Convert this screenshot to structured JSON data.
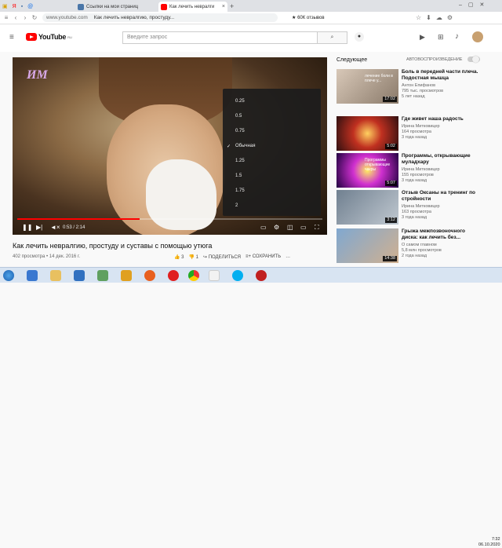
{
  "browser": {
    "tabs": [
      {
        "label": "Ссылки на мои страниц",
        "color": "#4a76a8"
      },
      {
        "label": "Как лечить невралги",
        "color": "#ff0000"
      }
    ],
    "url_domain": "www.youtube.com",
    "url_rest": "Как лечить невралгию, простуду...",
    "rating_star": "★",
    "rating_label": "60К отзывов"
  },
  "header": {
    "logo_text": "YouTube",
    "logo_region": "RU",
    "search_placeholder": "Введите запрос"
  },
  "player": {
    "watermark": "ИМ",
    "time": "0:53 / 2:14",
    "progress": 0.4,
    "speed_options": [
      "0.25",
      "0.5",
      "0.75",
      "Обычная",
      "1.25",
      "1.5",
      "1.75",
      "2"
    ],
    "speed_selected": "Обычная"
  },
  "video": {
    "title": "Как лечить невралгию, простуду и суставы с помощью утюга",
    "meta": "402 просмотра • 14 дек. 2016 г.",
    "likes": "3",
    "dislikes": "1",
    "share": "ПОДЕЛИТЬСЯ",
    "save": "СОХРАНИТЬ"
  },
  "sidebar": {
    "up_next": "Следующее",
    "autoplay": "АВТОВОСПРОИЗВЕДЕНИЕ",
    "items": [
      {
        "title": "Боль в передней части плеча. Подостная мышца",
        "channel": "Антон Епифанов",
        "meta": "795 тыс. просмотров",
        "age": "5 лет назад",
        "duration": "17:02",
        "thumb_text": "лечение боли в плече у..."
      },
      {
        "title": "Где живет наша радость",
        "channel": "Ирина Митковицер",
        "meta": "164 просмотра",
        "age": "3 года назад",
        "duration": "5:02",
        "thumb_text": ""
      },
      {
        "title": "Программы, открывающие муладхару",
        "channel": "Ирина Митковицер",
        "meta": "155 просмотров",
        "age": "3 года назад",
        "duration": "5:07",
        "thumb_text": "Программы открывающие чакры"
      },
      {
        "title": "Отзыв Оксаны на тренинг по стройности",
        "channel": "Ирина Митковицер",
        "meta": "163 просмотра",
        "age": "3 года назад",
        "duration": "3:12",
        "thumb_text": ""
      },
      {
        "title": "Грыжа межпозвоночного диска: как лечить без...",
        "channel": "О самом главном",
        "meta": "5,8 млн просмотров",
        "age": "2 года назад",
        "duration": "14:38",
        "thumb_text": ""
      }
    ]
  },
  "taskbar": {
    "time": "7:32",
    "date": "06.10.2020"
  }
}
